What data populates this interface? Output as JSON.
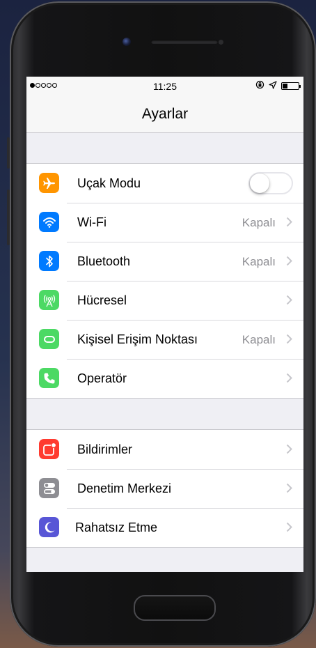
{
  "status_bar": {
    "signal_filled": 1,
    "signal_total": 5,
    "time": "11:25",
    "battery_level": 0.3
  },
  "header": {
    "title": "Ayarlar"
  },
  "groups": [
    {
      "items": [
        {
          "label": "Uçak Modu",
          "icon": "airplane-icon",
          "color": "#ff9500",
          "control": "toggle",
          "on": false
        },
        {
          "label": "Wi-Fi",
          "icon": "wifi-icon",
          "color": "#007aff",
          "value": "Kapalı"
        },
        {
          "label": "Bluetooth",
          "icon": "bluetooth-icon",
          "color": "#007aff",
          "value": "Kapalı"
        },
        {
          "label": "Hücresel",
          "icon": "cellular-antenna-icon",
          "color": "#4cd964",
          "value": ""
        },
        {
          "label": "Kişisel Erişim Noktası",
          "icon": "hotspot-link-icon",
          "color": "#4cd964",
          "value": "Kapalı"
        },
        {
          "label": "Operatör",
          "icon": "phone-icon",
          "color": "#4cd964",
          "value": ""
        }
      ]
    },
    {
      "items": [
        {
          "label": "Bildirimler",
          "icon": "notifications-icon",
          "color": "#ff3b30",
          "value": ""
        },
        {
          "label": "Denetim Merkezi",
          "icon": "control-center-icon",
          "color": "#8e8e93",
          "value": ""
        },
        {
          "label": "Rahatsız Etme",
          "icon": "moon-icon",
          "color": "#5856d6",
          "value": ""
        }
      ]
    }
  ]
}
